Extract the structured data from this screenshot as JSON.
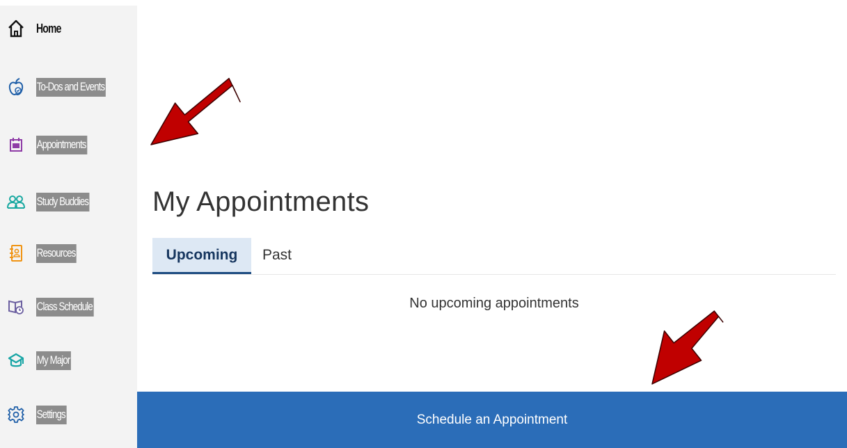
{
  "sidebar": {
    "items": [
      {
        "label": "Home",
        "icon": "home-icon",
        "color": "#111111"
      },
      {
        "label": "To-Dos and Events",
        "icon": "apple-icon",
        "color": "#1f5fa8"
      },
      {
        "label": "Appointments",
        "icon": "calendar-icon",
        "color": "#8e3ba6"
      },
      {
        "label": "Study Buddies",
        "icon": "people-icon",
        "color": "#18a8a0"
      },
      {
        "label": "Resources",
        "icon": "address-book-icon",
        "color": "#f09312"
      },
      {
        "label": "Class Schedule",
        "icon": "book-icon",
        "color": "#6b5fa0"
      },
      {
        "label": "My Major",
        "icon": "graduation-cap-icon",
        "color": "#17a5a5"
      },
      {
        "label": "Settings",
        "icon": "gear-icon",
        "color": "#1f5fa8"
      }
    ]
  },
  "main": {
    "title": "My Appointments",
    "tabs": [
      {
        "label": "Upcoming",
        "active": true
      },
      {
        "label": "Past",
        "active": false
      }
    ],
    "empty_message": "No upcoming appointments",
    "schedule_button": "Schedule an Appointment"
  },
  "colors": {
    "accent": "#2b6db8",
    "active_tab_bg": "#dde8f4",
    "active_tab_border": "#1b4a80",
    "arrow": "#c00000"
  }
}
